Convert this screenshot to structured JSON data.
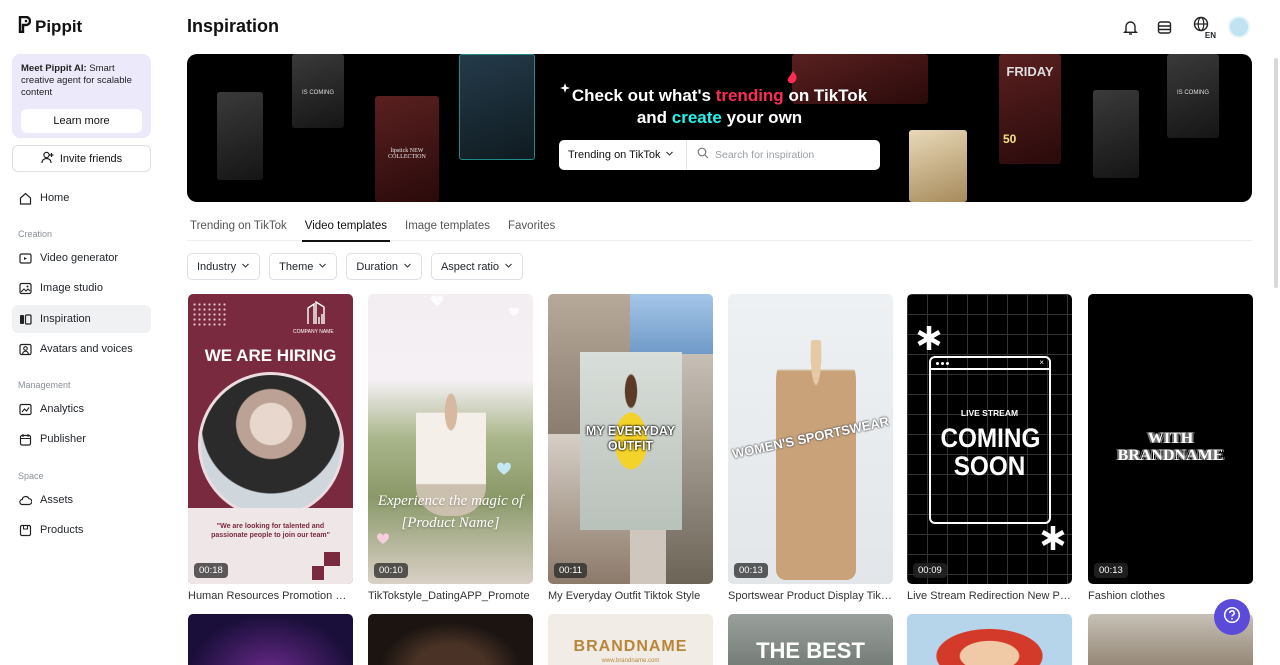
{
  "app": {
    "name": "Pippit"
  },
  "sidebar": {
    "promo_title": "Meet Pippit AI:",
    "promo_text": "Smart creative agent for scalable content",
    "learn_more": "Learn more",
    "invite": "Invite friends",
    "home": "Home",
    "sections": {
      "creation": "Creation",
      "management": "Management",
      "space": "Space"
    },
    "creation_items": [
      "Video generator",
      "Image studio",
      "Inspiration",
      "Avatars and voices"
    ],
    "management_items": [
      "Analytics",
      "Publisher"
    ],
    "space_items": [
      "Assets",
      "Products"
    ]
  },
  "header": {
    "title": "Inspiration",
    "lang": "EN"
  },
  "banner": {
    "line1_pre": "Check out what's",
    "line1_highlight": "trending",
    "line1_post": "on TikTok",
    "line2_pre": "and",
    "line2_highlight": "create",
    "line2_post": "your own",
    "select_value": "Trending on TikTok",
    "search_placeholder": "Search for inspiration",
    "phone_labels": [
      "IS COMING",
      "lipstick NEW COLLECTION",
      "FRIDAY",
      "IS COMING",
      "50"
    ]
  },
  "tabs": [
    "Trending on TikTok",
    "Video templates",
    "Image templates",
    "Favorites"
  ],
  "filters": [
    "Industry",
    "Theme",
    "Duration",
    "Aspect ratio"
  ],
  "cards": [
    {
      "title": "Human Resources Promotion Bu...",
      "duration": "00:18",
      "headline": "WE ARE HIRING",
      "company": "COMPANY NAME",
      "quote": "\"We are looking for talented and passionate people to join our team\""
    },
    {
      "title": "TikTokstyle_DatingAPP_Promote",
      "duration": "00:10",
      "headline": "Experience the magic of [Product Name]"
    },
    {
      "title": "My Everyday Outfit Tiktok Style",
      "duration": "00:11",
      "headline": "MY EVERYDAY OUTFIT"
    },
    {
      "title": "Sportswear Product Display TikT...",
      "duration": "00:13",
      "headline": "WOMEN'S SPORTSWEAR"
    },
    {
      "title": "Live Stream Redirection New Pr...",
      "duration": "00:09",
      "headline_small": "LIVE STREAM",
      "headline": "COMING SOON"
    },
    {
      "title": "Fashion clothes",
      "duration": "00:13",
      "headline": "WITH BRANDNAME"
    }
  ],
  "row2": [
    {
      "headline": ""
    },
    {
      "headline": ""
    },
    {
      "headline": "BRANDNAME",
      "sub": "www.brandname.com"
    },
    {
      "headline": "THE BEST"
    },
    {
      "headline": ""
    },
    {
      "headline": ""
    }
  ],
  "colors": {
    "accent": "#5b4bdb",
    "pink": "#fe2c55",
    "cyan": "#25f4ee",
    "hiring": "#7a2a3e"
  }
}
